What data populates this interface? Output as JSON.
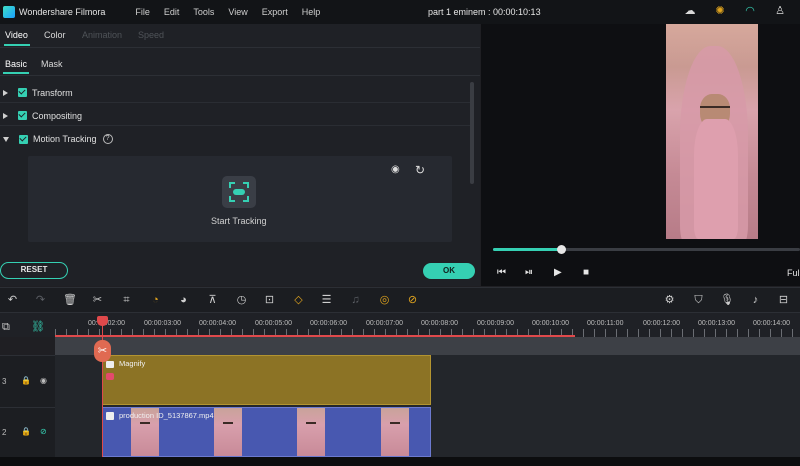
{
  "app": {
    "name": "Wondershare Filmora",
    "menu": [
      "File",
      "Edit",
      "Tools",
      "View",
      "Export",
      "Help"
    ],
    "project_title": "part 1 eminem : 00:00:10:13"
  },
  "panel": {
    "tabs": [
      "Video",
      "Color",
      "Animation",
      "Speed"
    ],
    "subtabs": [
      "Basic",
      "Mask"
    ],
    "sections": {
      "transform": "Transform",
      "compositing": "Compositing",
      "motion_tracking": "Motion Tracking"
    },
    "help_glyph": "?",
    "start_tracking": "Start Tracking",
    "reset": "RESET",
    "ok": "OK"
  },
  "preview": {
    "progress": 0.22,
    "zoom_label": "Full"
  },
  "timeline": {
    "timecodes": [
      "00:00:02:00",
      "00:00:03:00",
      "00:00:04:00",
      "00:00:05:00",
      "00:00:06:00",
      "00:00:07:00",
      "00:00:08:00",
      "00:00:09:00",
      "00:00:10:00",
      "00:00:11:00",
      "00:00:12:00",
      "00:00:13:00",
      "00:00:14:00"
    ],
    "tracks": [
      {
        "number": "3",
        "clip": "Magnify"
      },
      {
        "number": "2",
        "clip": "production ID_5137867.mp4"
      }
    ]
  },
  "colors": {
    "accent": "#35d0b3",
    "playhead": "#e0494b",
    "effect_clip": "#8c7325",
    "video_clip": "#4858b0"
  }
}
